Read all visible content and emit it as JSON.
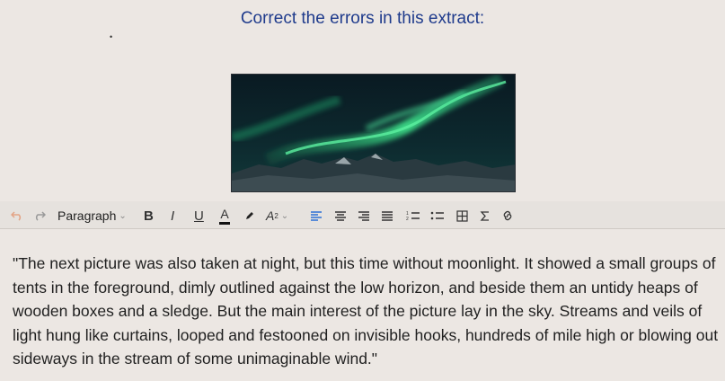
{
  "prompt": {
    "title": "Correct the errors in this extract:"
  },
  "image": {
    "description_icon": "aurora-landscape-image"
  },
  "toolbar": {
    "undo_icon": "undo-icon",
    "redo_icon": "redo-icon",
    "paragraph_label": "Paragraph",
    "bold_label": "B",
    "italic_label": "I",
    "underline_label": "U",
    "font_color_label": "A",
    "superscript_label": "A",
    "superscript_sup": "2"
  },
  "editor": {
    "text": "\"The next picture was also taken at night, but this time without moonlight. It showed a small groups of tents in the foreground, dimly outlined against the low horizon, and beside them an untidy heaps of wooden boxes and a sledge. But the main interest of the picture lay in the sky. Streams and veils of light hung like curtains, looped and festooned on invisible hooks, hundreds of mile high or blowing out sideways in the stream of some unimaginable wind.\""
  },
  "colors": {
    "prompt_text": "#1f3b8c",
    "active_align": "#2b6fd6",
    "aurora": "#34d07a"
  }
}
